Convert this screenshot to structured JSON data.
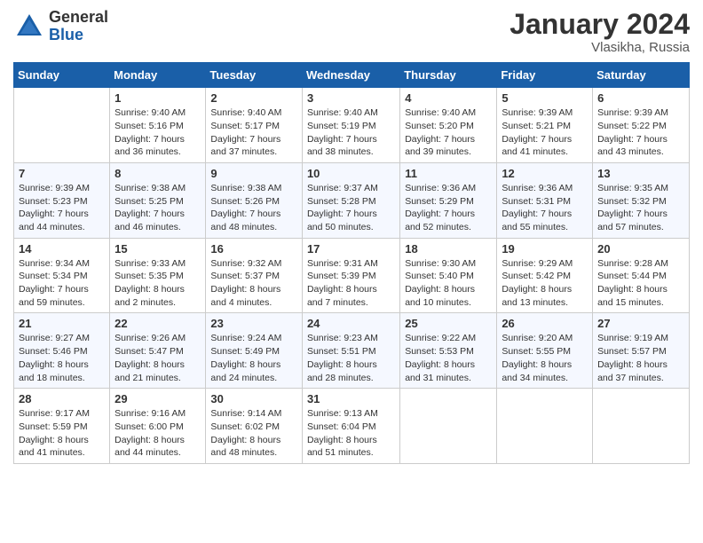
{
  "logo": {
    "general": "General",
    "blue": "Blue"
  },
  "title": "January 2024",
  "location": "Vlasikha, Russia",
  "days_of_week": [
    "Sunday",
    "Monday",
    "Tuesday",
    "Wednesday",
    "Thursday",
    "Friday",
    "Saturday"
  ],
  "weeks": [
    [
      {
        "day": "",
        "info": ""
      },
      {
        "day": "1",
        "info": "Sunrise: 9:40 AM\nSunset: 5:16 PM\nDaylight: 7 hours\nand 36 minutes."
      },
      {
        "day": "2",
        "info": "Sunrise: 9:40 AM\nSunset: 5:17 PM\nDaylight: 7 hours\nand 37 minutes."
      },
      {
        "day": "3",
        "info": "Sunrise: 9:40 AM\nSunset: 5:19 PM\nDaylight: 7 hours\nand 38 minutes."
      },
      {
        "day": "4",
        "info": "Sunrise: 9:40 AM\nSunset: 5:20 PM\nDaylight: 7 hours\nand 39 minutes."
      },
      {
        "day": "5",
        "info": "Sunrise: 9:39 AM\nSunset: 5:21 PM\nDaylight: 7 hours\nand 41 minutes."
      },
      {
        "day": "6",
        "info": "Sunrise: 9:39 AM\nSunset: 5:22 PM\nDaylight: 7 hours\nand 43 minutes."
      }
    ],
    [
      {
        "day": "7",
        "info": "Sunrise: 9:39 AM\nSunset: 5:23 PM\nDaylight: 7 hours\nand 44 minutes."
      },
      {
        "day": "8",
        "info": "Sunrise: 9:38 AM\nSunset: 5:25 PM\nDaylight: 7 hours\nand 46 minutes."
      },
      {
        "day": "9",
        "info": "Sunrise: 9:38 AM\nSunset: 5:26 PM\nDaylight: 7 hours\nand 48 minutes."
      },
      {
        "day": "10",
        "info": "Sunrise: 9:37 AM\nSunset: 5:28 PM\nDaylight: 7 hours\nand 50 minutes."
      },
      {
        "day": "11",
        "info": "Sunrise: 9:36 AM\nSunset: 5:29 PM\nDaylight: 7 hours\nand 52 minutes."
      },
      {
        "day": "12",
        "info": "Sunrise: 9:36 AM\nSunset: 5:31 PM\nDaylight: 7 hours\nand 55 minutes."
      },
      {
        "day": "13",
        "info": "Sunrise: 9:35 AM\nSunset: 5:32 PM\nDaylight: 7 hours\nand 57 minutes."
      }
    ],
    [
      {
        "day": "14",
        "info": "Sunrise: 9:34 AM\nSunset: 5:34 PM\nDaylight: 7 hours\nand 59 minutes."
      },
      {
        "day": "15",
        "info": "Sunrise: 9:33 AM\nSunset: 5:35 PM\nDaylight: 8 hours\nand 2 minutes."
      },
      {
        "day": "16",
        "info": "Sunrise: 9:32 AM\nSunset: 5:37 PM\nDaylight: 8 hours\nand 4 minutes."
      },
      {
        "day": "17",
        "info": "Sunrise: 9:31 AM\nSunset: 5:39 PM\nDaylight: 8 hours\nand 7 minutes."
      },
      {
        "day": "18",
        "info": "Sunrise: 9:30 AM\nSunset: 5:40 PM\nDaylight: 8 hours\nand 10 minutes."
      },
      {
        "day": "19",
        "info": "Sunrise: 9:29 AM\nSunset: 5:42 PM\nDaylight: 8 hours\nand 13 minutes."
      },
      {
        "day": "20",
        "info": "Sunrise: 9:28 AM\nSunset: 5:44 PM\nDaylight: 8 hours\nand 15 minutes."
      }
    ],
    [
      {
        "day": "21",
        "info": "Sunrise: 9:27 AM\nSunset: 5:46 PM\nDaylight: 8 hours\nand 18 minutes."
      },
      {
        "day": "22",
        "info": "Sunrise: 9:26 AM\nSunset: 5:47 PM\nDaylight: 8 hours\nand 21 minutes."
      },
      {
        "day": "23",
        "info": "Sunrise: 9:24 AM\nSunset: 5:49 PM\nDaylight: 8 hours\nand 24 minutes."
      },
      {
        "day": "24",
        "info": "Sunrise: 9:23 AM\nSunset: 5:51 PM\nDaylight: 8 hours\nand 28 minutes."
      },
      {
        "day": "25",
        "info": "Sunrise: 9:22 AM\nSunset: 5:53 PM\nDaylight: 8 hours\nand 31 minutes."
      },
      {
        "day": "26",
        "info": "Sunrise: 9:20 AM\nSunset: 5:55 PM\nDaylight: 8 hours\nand 34 minutes."
      },
      {
        "day": "27",
        "info": "Sunrise: 9:19 AM\nSunset: 5:57 PM\nDaylight: 8 hours\nand 37 minutes."
      }
    ],
    [
      {
        "day": "28",
        "info": "Sunrise: 9:17 AM\nSunset: 5:59 PM\nDaylight: 8 hours\nand 41 minutes."
      },
      {
        "day": "29",
        "info": "Sunrise: 9:16 AM\nSunset: 6:00 PM\nDaylight: 8 hours\nand 44 minutes."
      },
      {
        "day": "30",
        "info": "Sunrise: 9:14 AM\nSunset: 6:02 PM\nDaylight: 8 hours\nand 48 minutes."
      },
      {
        "day": "31",
        "info": "Sunrise: 9:13 AM\nSunset: 6:04 PM\nDaylight: 8 hours\nand 51 minutes."
      },
      {
        "day": "",
        "info": ""
      },
      {
        "day": "",
        "info": ""
      },
      {
        "day": "",
        "info": ""
      }
    ]
  ]
}
